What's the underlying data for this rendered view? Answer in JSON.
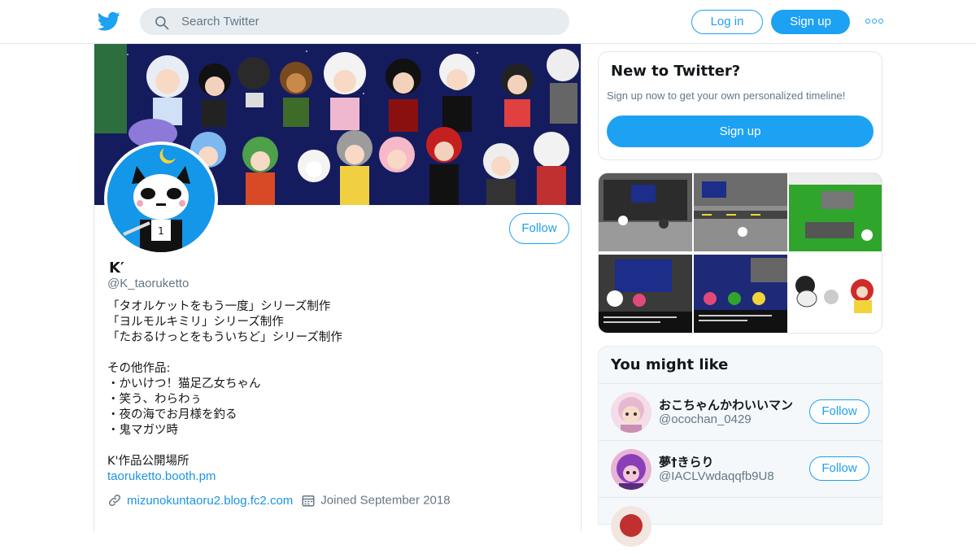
{
  "colors": {
    "brand": "#1da1f2",
    "link": "#1b95e0",
    "text_primary": "#14171a",
    "text_secondary": "#657786",
    "border": "#e1e8ed",
    "search_bg": "#e6ecf0"
  },
  "topbar": {
    "logo_icon": "twitter-bird-icon",
    "search_icon": "search-icon",
    "search_placeholder": "Search Twitter",
    "login_label": "Log in",
    "signup_label": "Sign up",
    "more_icon": "more-dots-icon"
  },
  "profile": {
    "banner": "pixel-art-character-collage",
    "avatar": "pixel-panda-avatar",
    "follow_label": "Follow",
    "name": "K′",
    "handle": "@K_taoruketto",
    "bio_lines": [
      "「タオルケットをもう一度」シリーズ制作",
      "「ヨルモルキミリ」シリーズ制作",
      "「たおるけっとをもういちど」シリーズ制作",
      "",
      "その他作品:",
      "・かいけつ！猫足乙女ちゃん",
      "・笑う、わらわぅ",
      "・夜の海でお月様を釣る",
      "・鬼マガツ時",
      "",
      "K'作品公開場所"
    ],
    "bio_link": "taoruketto.booth.pm",
    "website_icon": "link-icon",
    "website": "mizunokuntaoru2.blog.fc2.com",
    "joined_icon": "calendar-icon",
    "joined": "Joined September 2018"
  },
  "signup_card": {
    "title": "New to Twitter?",
    "subtitle": "Sign up now to get your own personalized timeline!",
    "button_label": "Sign up"
  },
  "media_grid": {
    "items": [
      "game-screenshot-room",
      "game-screenshot-street",
      "game-screenshot-green",
      "game-screenshot-stage",
      "game-screenshot-night",
      "pixel-art-characters"
    ]
  },
  "suggestions": {
    "title": "You might like",
    "items": [
      {
        "name": "おこちゃんかわいいマン",
        "handle": "@ocochan_0429",
        "follow_label": "Follow",
        "avatar": "anime-girl-avatar"
      },
      {
        "name": "夢†きらり",
        "handle": "@IACLVwdaqqfb9U8",
        "follow_label": "Follow",
        "avatar": "purple-hair-avatar"
      }
    ]
  }
}
